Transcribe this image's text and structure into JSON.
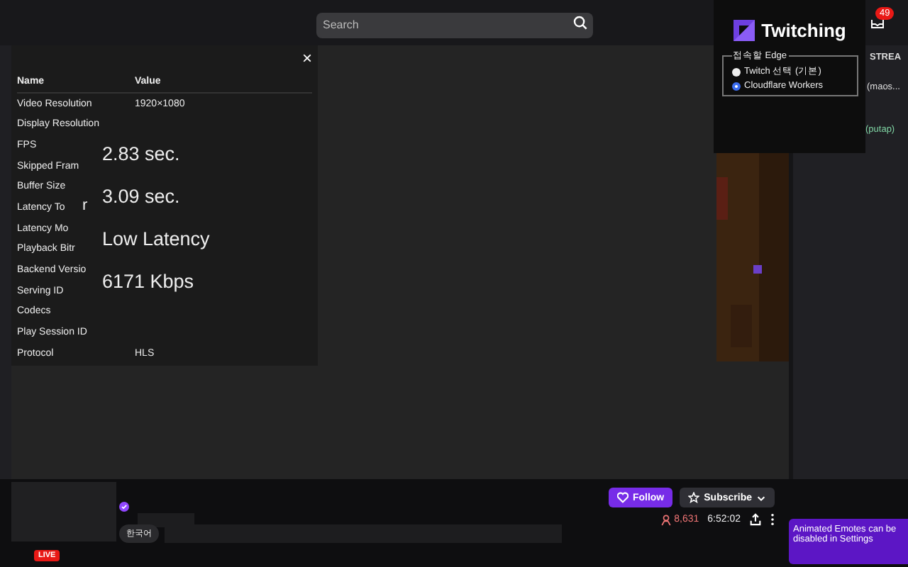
{
  "search": {
    "placeholder": "Search"
  },
  "notifications": {
    "count": "49"
  },
  "extension_popup": {
    "title": "Twitching",
    "group_label": "접속할 Edge",
    "options": [
      {
        "label": "Twitch 선택 (기본)",
        "selected": false
      },
      {
        "label": "Cloudflare Workers",
        "selected": true
      }
    ]
  },
  "side_texts": [
    {
      "text": "STREA",
      "kind": "heading"
    },
    {
      "text": "(maos...",
      "kind": "chat"
    },
    {
      "text": "(putap)",
      "kind": "mention"
    }
  ],
  "stats": {
    "close": "×",
    "columns": [
      "Name",
      "Value"
    ],
    "rows": [
      {
        "name": "Video Resolution",
        "value": "1920×1080"
      },
      {
        "name": "Display Resolution"
      },
      {
        "name": "FPS"
      },
      {
        "name": "Skipped Fram"
      },
      {
        "name": "Buffer Size"
      },
      {
        "name": "Latency To",
        "fragment": "r"
      },
      {
        "name": "Latency Mo"
      },
      {
        "name": "Playback Bitr"
      },
      {
        "name": "Backend Versio"
      },
      {
        "name": "Serving ID"
      },
      {
        "name": "Codecs"
      },
      {
        "name": "Play Session ID"
      },
      {
        "name": "Protocol",
        "value": "HLS"
      }
    ],
    "overlay_values": [
      "2.83 sec.",
      "3.09 sec.",
      "Low Latency",
      "6171 Kbps"
    ]
  },
  "channel": {
    "live": "LIVE",
    "tag": "한국어",
    "follow": "Follow",
    "subscribe": "Subscribe",
    "viewers": "8,631",
    "uptime": "6:52:02"
  },
  "toast": {
    "text": "Animated Emotes can be disabled in Settings"
  }
}
